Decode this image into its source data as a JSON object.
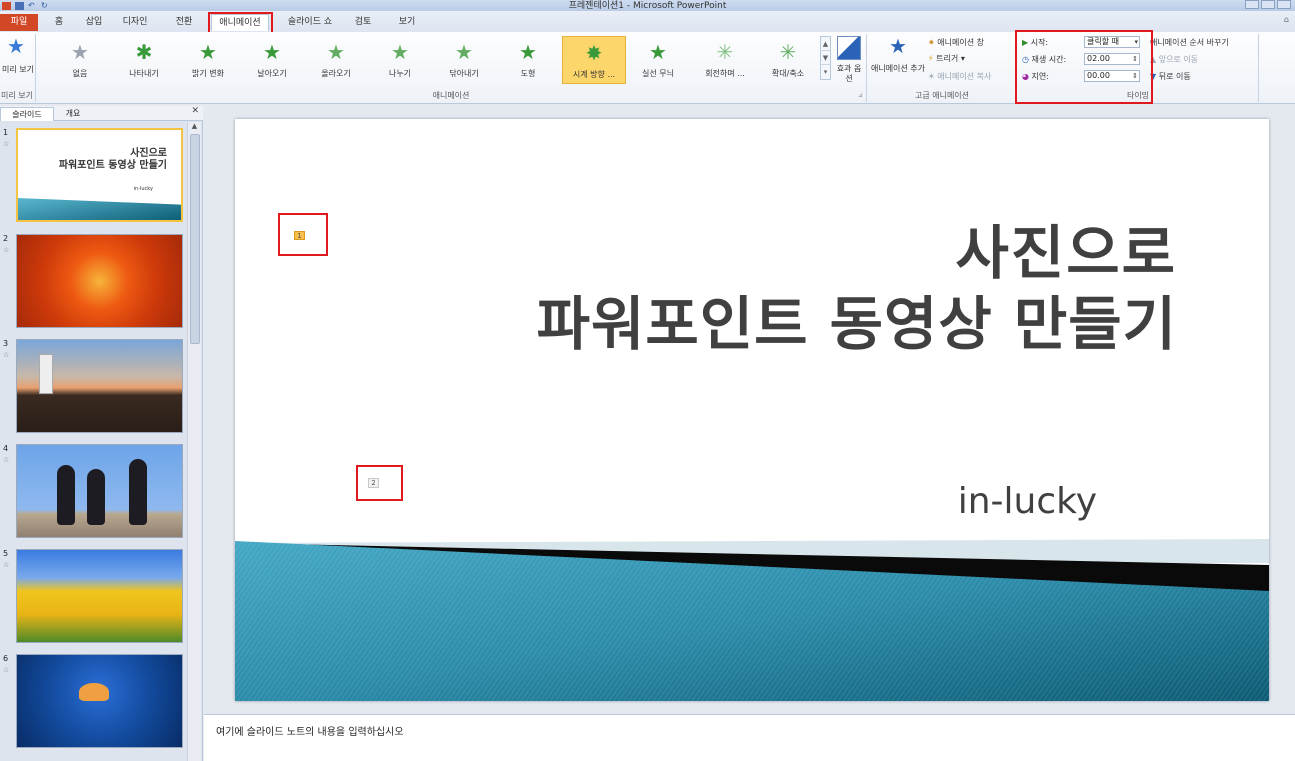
{
  "window": {
    "title": "프레젠테이션1 - Microsoft PowerPoint"
  },
  "tabs": [
    {
      "label": "파일"
    },
    {
      "label": "홈"
    },
    {
      "label": "삽입"
    },
    {
      "label": "디자인"
    },
    {
      "label": "전환"
    },
    {
      "label": "애니메이션"
    },
    {
      "label": "슬라이드 쇼"
    },
    {
      "label": "검토"
    },
    {
      "label": "보기"
    }
  ],
  "ribbon": {
    "preview": {
      "label": "미리 보기",
      "group": "미리 보기"
    },
    "animations": [
      {
        "label": "없음"
      },
      {
        "label": "나타내기"
      },
      {
        "label": "밝기 변화"
      },
      {
        "label": "날아오기"
      },
      {
        "label": "올라오기"
      },
      {
        "label": "나누기"
      },
      {
        "label": "닦아내기"
      },
      {
        "label": "도형"
      },
      {
        "label": "시계 방향 ..."
      },
      {
        "label": "실선 무늬"
      },
      {
        "label": "회전하며 ..."
      },
      {
        "label": "확대/축소"
      }
    ],
    "effect_options": "효과 옵션",
    "animation_group": "애니메이션",
    "advanced": {
      "add_animation": "애니메이션 추가",
      "animation_pane": "애니메이션 창",
      "trigger": "트리거",
      "animation_painter": "애니메이션 복사",
      "group": "고급 애니메이션"
    },
    "timing": {
      "start_label": "시작:",
      "start_value": "클릭할 때",
      "duration_label": "재생 시간:",
      "duration_value": "02.00",
      "delay_label": "지연:",
      "delay_value": "00.00",
      "reorder": "애니메이션 순서 바꾸기",
      "move_earlier": "앞으로 이동",
      "move_later": "뒤로 이동",
      "group": "타이밍"
    }
  },
  "left_pane": {
    "tabs": [
      "슬라이드",
      "개요"
    ],
    "slides": [
      {
        "number": "1",
        "title": "사진으로",
        "subtitle": "파워포인트 동영상 만들기",
        "footer": "in-lucky"
      },
      {
        "number": "2"
      },
      {
        "number": "3"
      },
      {
        "number": "4"
      },
      {
        "number": "5"
      },
      {
        "number": "6"
      }
    ]
  },
  "slide": {
    "title_line1": "사진으로",
    "title_line2": "파워포인트 동영상 만들기",
    "subtitle": "in-lucky",
    "anim_tag_1": "1",
    "anim_tag_2": "2"
  },
  "notes": {
    "placeholder": "여기에 슬라이드 노트의 내용을 입력하십시오"
  }
}
